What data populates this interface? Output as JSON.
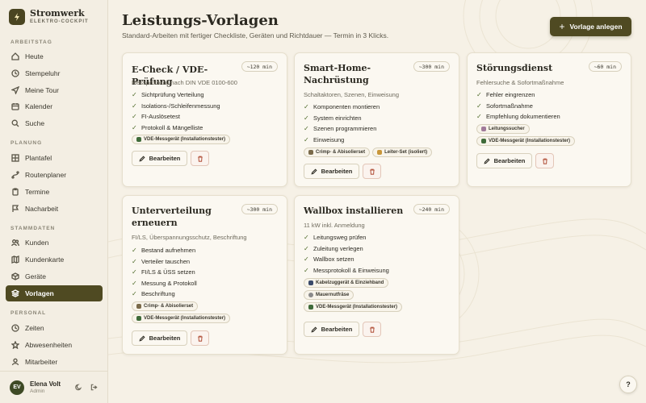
{
  "brand": {
    "name": "Stromwerk",
    "sub": "ELEKTRO-COCKPIT",
    "icon": "lightning-icon"
  },
  "sidebar": {
    "sections": [
      {
        "label": "ARBEITSTAG",
        "items": [
          {
            "label": "Heute",
            "icon": "home-icon"
          },
          {
            "label": "Stempeluhr",
            "icon": "clock-icon"
          },
          {
            "label": "Meine Tour",
            "icon": "send-icon"
          },
          {
            "label": "Kalender",
            "icon": "calendar-icon"
          },
          {
            "label": "Suche",
            "icon": "search-icon"
          }
        ]
      },
      {
        "label": "PLANUNG",
        "items": [
          {
            "label": "Plantafel",
            "icon": "grid-icon"
          },
          {
            "label": "Routenplaner",
            "icon": "route-icon"
          },
          {
            "label": "Termine",
            "icon": "clipboard-icon"
          },
          {
            "label": "Nacharbeit",
            "icon": "flag-icon"
          }
        ]
      },
      {
        "label": "STAMMDATEN",
        "items": [
          {
            "label": "Kunden",
            "icon": "users-icon"
          },
          {
            "label": "Kundenkarte",
            "icon": "map-icon"
          },
          {
            "label": "Geräte",
            "icon": "box-icon"
          },
          {
            "label": "Vorlagen",
            "icon": "layers-icon",
            "active": true
          }
        ]
      },
      {
        "label": "PERSONAL",
        "items": [
          {
            "label": "Zeiten",
            "icon": "clock-icon"
          },
          {
            "label": "Abwesenheiten",
            "icon": "sun-icon"
          },
          {
            "label": "Mitarbeiter",
            "icon": "user-icon"
          }
        ]
      }
    ]
  },
  "user": {
    "initials": "EV",
    "name": "Elena Volt",
    "role": "Admin"
  },
  "header": {
    "title": "Leistungs-Vorlagen",
    "subtitle": "Standard-Arbeiten mit fertiger Checkliste, Geräten und Richtdauer — Termin in 3 Klicks.",
    "add_label": "Vorlage anlegen"
  },
  "cards": [
    {
      "title": "E-Check / VDE-Prüfung",
      "duration": "~120 min",
      "desc": "Messprotokoll nach DIN VDE 0100-600",
      "checks": [
        "Sichtprüfung Verteilung",
        "Isolations-/Schleifenmessung",
        "FI-Auslösetest",
        "Protokoll & Mängelliste"
      ],
      "tags": [
        {
          "label": "VDE-Messgerät (Installationstester)",
          "color": "#3f6b3a"
        }
      ]
    },
    {
      "title": "Smart-Home-Nachrüstung",
      "duration": "~300 min",
      "desc": "Schaltaktoren, Szenen, Einweisung",
      "checks": [
        "Komponenten montieren",
        "System einrichten",
        "Szenen programmieren",
        "Einweisung"
      ],
      "tags": [
        {
          "label": "Crimp- & Abisolierset",
          "color": "#7a6a4a"
        },
        {
          "label": "Leiter-Set (isoliert)",
          "color": "#c8963a"
        }
      ]
    },
    {
      "title": "Störungsdienst",
      "duration": "~60 min",
      "desc": "Fehlersuche & Sofortmaßnahme",
      "checks": [
        "Fehler eingrenzen",
        "Sofortmaßnahme",
        "Empfehlung dokumentieren"
      ],
      "tags": [
        {
          "label": "Leitungssucher",
          "color": "#a07a9a"
        },
        {
          "label": "VDE-Messgerät (Installationstester)",
          "color": "#3f6b3a"
        }
      ]
    },
    {
      "title": "Unterverteilung erneuern",
      "duration": "~300 min",
      "desc": "FI/LS, Überspannungsschutz, Beschriftung",
      "checks": [
        "Bestand aufnehmen",
        "Verteiler tauschen",
        "FI/LS & ÜSS setzen",
        "Messung & Protokoll",
        "Beschriftung"
      ],
      "tags": [
        {
          "label": "Crimp- & Abisolierset",
          "color": "#7a6a4a"
        },
        {
          "label": "VDE-Messgerät (Installationstester)",
          "color": "#3f6b3a"
        }
      ]
    },
    {
      "title": "Wallbox installieren",
      "duration": "~240 min",
      "desc": "11 kW inkl. Anmeldung",
      "checks": [
        "Leitungsweg prüfen",
        "Zuleitung verlegen",
        "Wallbox setzen",
        "Messprotokoll & Einweisung"
      ],
      "tags": [
        {
          "label": "Kabelzuggerät & Einziehband",
          "color": "#3a4a6a"
        },
        {
          "label": "Mauernutfräse",
          "color": "#8a8a8a"
        },
        {
          "label": "VDE-Messgerät (Installationstester)",
          "color": "#3f6b3a"
        }
      ]
    }
  ],
  "edit_label": "Bearbeiten",
  "help_label": "?"
}
